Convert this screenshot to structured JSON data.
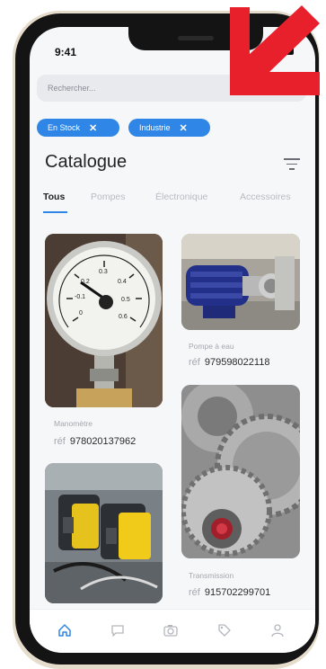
{
  "status": {
    "time": "9:41"
  },
  "search": {
    "placeholder": "Rechercher..."
  },
  "filters": [
    {
      "label": "En Stock"
    },
    {
      "label": "Industrie"
    }
  ],
  "header": {
    "title": "Catalogue"
  },
  "tabs": [
    "Tous",
    "Pompes",
    "Électronique",
    "Accessoires"
  ],
  "products": [
    {
      "name": "Manomètre",
      "ref_label": "réf",
      "ref": "978020137962"
    },
    {
      "name": "Pompe à eau",
      "ref_label": "réf",
      "ref": "979598022118"
    },
    {
      "name": "Transmission",
      "ref_label": "réf",
      "ref": "915702299701"
    }
  ],
  "colors": {
    "accent": "#2f86e6",
    "overlay_arrow": "#e8202b"
  },
  "tabbar": [
    "home-icon",
    "chat-icon",
    "camera-icon",
    "tag-icon",
    "profile-icon"
  ]
}
